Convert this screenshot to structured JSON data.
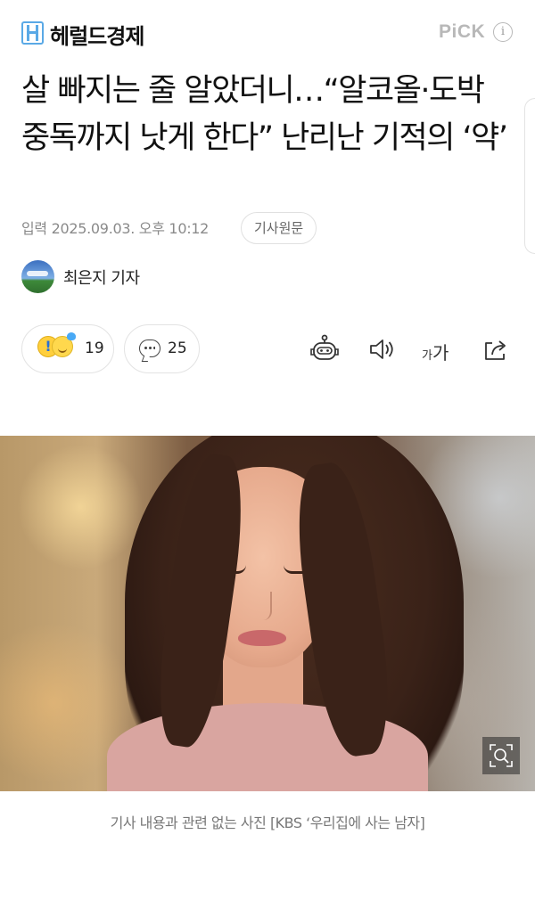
{
  "header": {
    "publisher": "헤럴드경제",
    "pick_label": "PiCK",
    "info_icon": "i"
  },
  "article": {
    "headline": "살 빠지는 줄 알았더니…“알코올·도박 중독까지 낫게 한다” 난리난 기적의 ‘약’",
    "date_label": "입력 2025.09.03. 오후 10:12",
    "original_button": "기사원문",
    "author": "최은지 기자"
  },
  "actions": {
    "reaction_count": "19",
    "comment_count": "25",
    "font_size_small": "가",
    "font_size_big": "가"
  },
  "photo": {
    "caption": "기사 내용과 관련 없는 사진 [KBS ‘우리집에 사는 남자]"
  },
  "colors": {
    "logo_blue": "#5aa9e6",
    "pick_gray": "#b8b8b8",
    "caption_gray": "#777777"
  },
  "icons": [
    "logo-h-icon",
    "info-icon",
    "emoji-surprised-icon",
    "emoji-smile-icon",
    "comment-bubble-icon",
    "robot-summary-icon",
    "speaker-icon",
    "share-icon",
    "zoom-icon"
  ]
}
